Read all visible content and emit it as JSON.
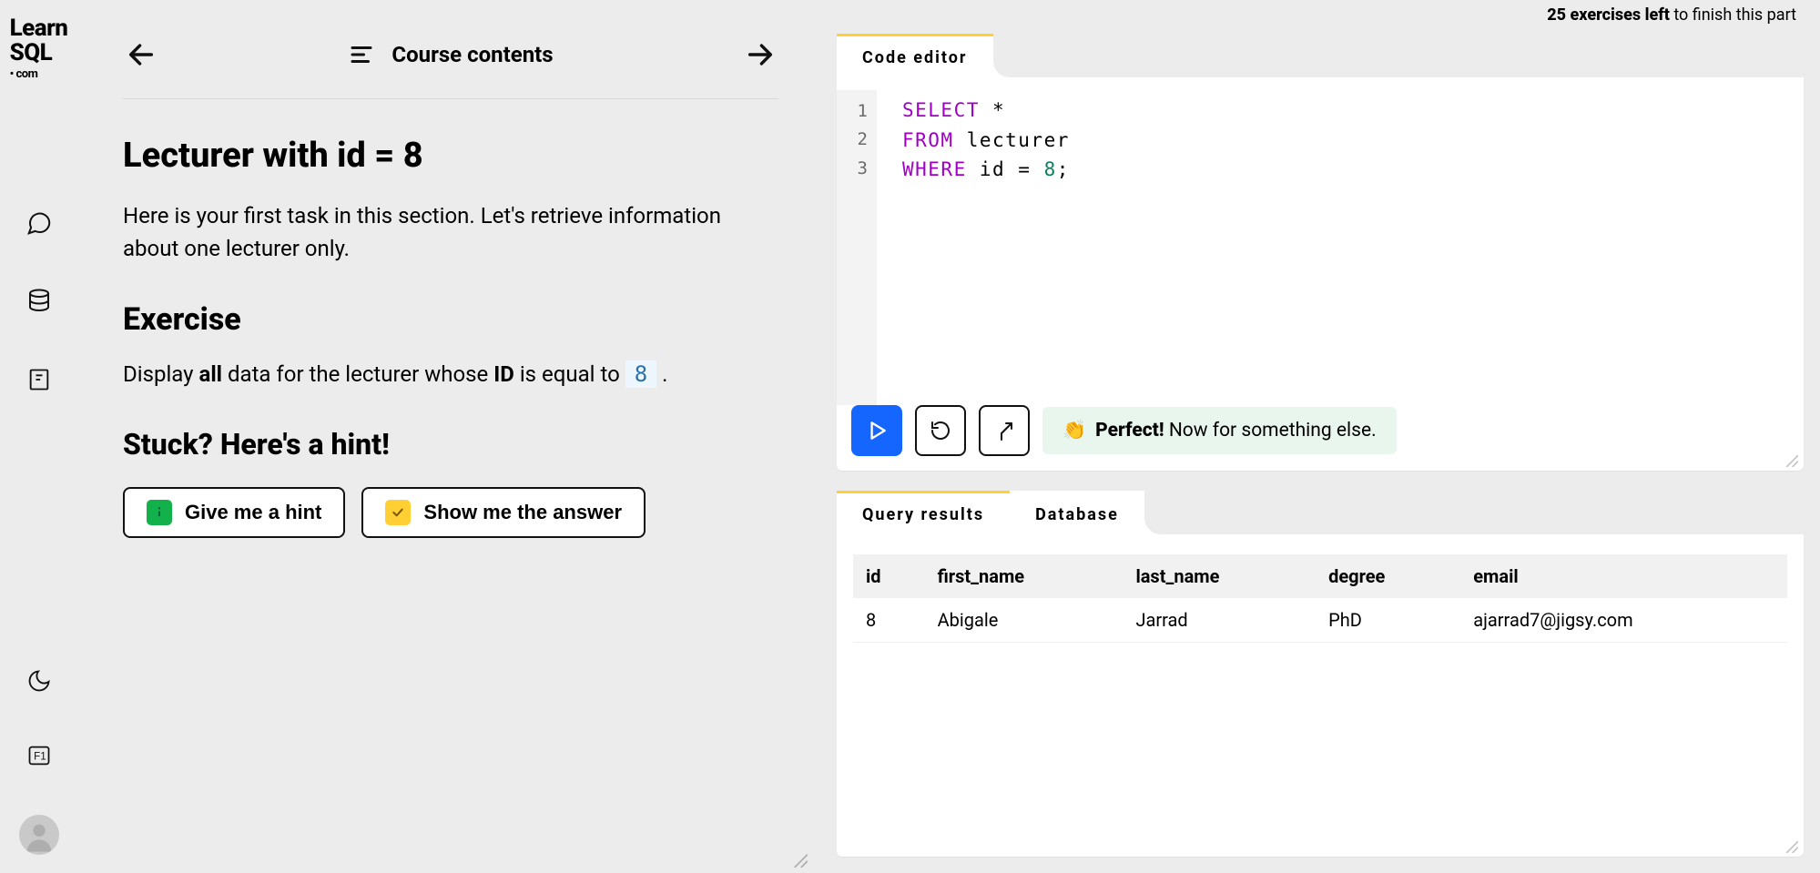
{
  "logo": {
    "line1": "Learn",
    "line2": "SQL",
    "dotcom": "• com"
  },
  "rail_icons": [
    "chat",
    "database",
    "note"
  ],
  "nav": {
    "prev": "back",
    "next": "forward",
    "contents_label": "Course contents"
  },
  "page": {
    "title": "Lecturer with id = 8",
    "intro": "Here is your first task in this section. Let's retrieve information about one lecturer only.",
    "exercise_heading": "Exercise",
    "exercise_prefix": "Display ",
    "exercise_bold1": "all",
    "exercise_mid": " data for the lecturer whose ",
    "exercise_bold2": "ID",
    "exercise_after": " is equal to ",
    "exercise_code": "8",
    "exercise_end": " .",
    "hint_heading": "Stuck? Here's a hint!",
    "hint_button": "Give me a hint",
    "answer_button": "Show me the answer"
  },
  "progress": {
    "count": "25",
    "mid": " exercises left",
    "tail": " to finish this part"
  },
  "editor": {
    "tab_label": "Code editor",
    "line_numbers": [
      "1",
      "2",
      "3"
    ],
    "code": {
      "l1_kw": "SELECT",
      "l1_rest": " *",
      "l2_kw": "FROM",
      "l2_rest": " lecturer",
      "l3_kw": "WHERE",
      "l3_mid": " id = ",
      "l3_num": "8",
      "l3_end": ";"
    },
    "feedback_emoji": "👏",
    "feedback_bold": "Perfect!",
    "feedback_rest": " Now for something else."
  },
  "results": {
    "tab_results": "Query results",
    "tab_database": "Database",
    "columns": [
      "id",
      "first_name",
      "last_name",
      "degree",
      "email"
    ],
    "rows": [
      {
        "id": "8",
        "first_name": "Abigale",
        "last_name": "Jarrad",
        "degree": "PhD",
        "email": "ajarrad7@jigsy.com"
      }
    ]
  }
}
